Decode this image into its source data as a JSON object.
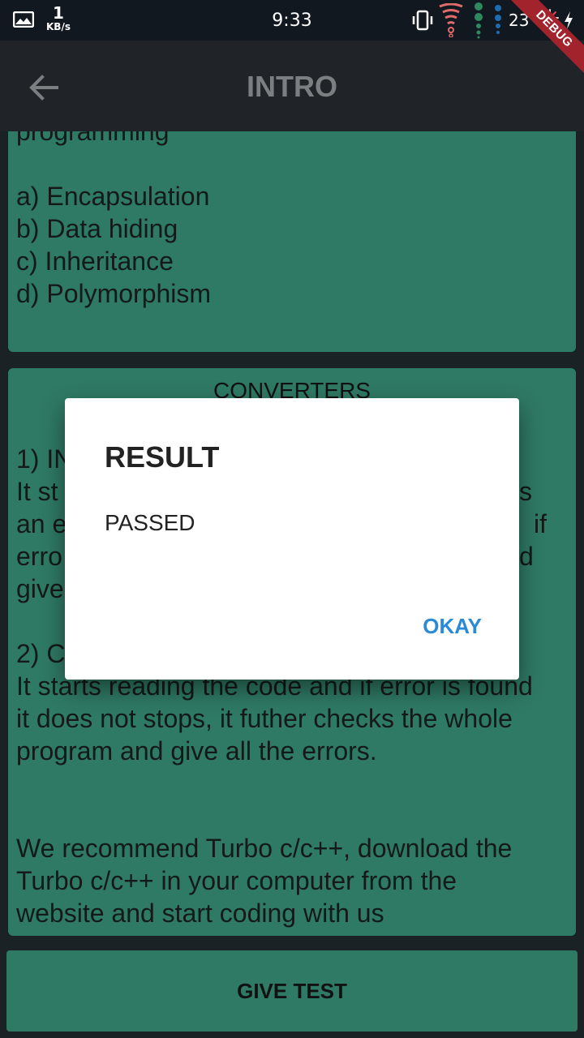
{
  "status_bar": {
    "net_speed_value": "1",
    "net_speed_unit": "KB/s",
    "time": "9:33",
    "battery": "23",
    "icons": [
      "photo-icon",
      "vibrate-icon",
      "wifi-icon",
      "signal-dots-icon",
      "battery-charging-icon"
    ]
  },
  "debug_banner": "DEBUG",
  "app_bar": {
    "title": "INTRO",
    "back_icon": "arrow-left-icon"
  },
  "card1": {
    "lines": [
      "programming",
      "",
      "a) Encapsulation",
      "b) Data hiding",
      "c) Inheritance",
      "d) Polymorphism"
    ]
  },
  "card2": {
    "title": "CONVERTERS",
    "lines": [
      "1) IN",
      "It st",
      "an e",
      "erro",
      "give",
      "",
      "2) C",
      "It starts reading the code and if error is found",
      "it does not stops, it futher checks the whole",
      "program and give all the errors.",
      "",
      "",
      "We recommend Turbo c/c++, download the",
      "Turbo c/c++ in your computer from the",
      "website and start coding with us"
    ],
    "right_fragments": [
      "s",
      "if",
      "d"
    ]
  },
  "give_test_label": "GIVE TEST",
  "dialog": {
    "title": "RESULT",
    "body": "PASSED",
    "ok_label": "OKAY"
  },
  "colors": {
    "card_green": "#2f7a64",
    "app_bar": "#202428",
    "accent_blue": "#2a8ad8",
    "debug_red": "#a3232c"
  }
}
